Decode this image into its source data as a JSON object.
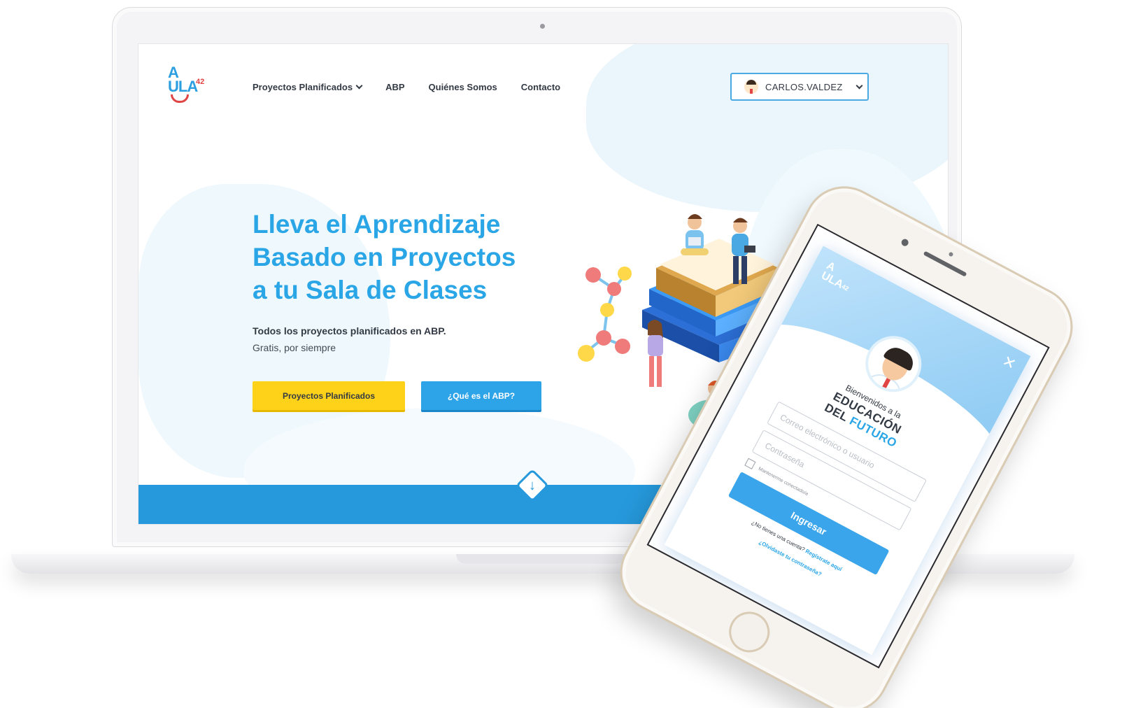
{
  "website": {
    "logo": {
      "top": "A",
      "middle": "ULA",
      "superscript": "42"
    },
    "nav": {
      "items": [
        {
          "label": "Proyectos Planificados",
          "has_dropdown": true
        },
        {
          "label": "ABP"
        },
        {
          "label": "Quiénes Somos"
        },
        {
          "label": "Contacto"
        }
      ]
    },
    "user_menu": {
      "username": "CARLOS.VALDEZ"
    },
    "hero": {
      "title_lines": [
        "Lleva el Aprendizaje",
        "Basado en Proyectos",
        "a tu Sala de Clases"
      ],
      "subtitle": "Todos los proyectos planificados en ABP.",
      "subtitle2": "Gratis, por siempre",
      "primary_button": "Proyectos Planificados",
      "secondary_button": "¿Qué es el ABP?"
    },
    "scroll_icon": "down-arrow-icon"
  },
  "mobile_login": {
    "logo": {
      "top": "A",
      "middle": "ULA",
      "superscript": "42"
    },
    "close_icon": "close-icon",
    "welcome": "Bienvenidos a la",
    "headline_line1": "EDUCACIÓN",
    "headline_line2_prefix": "DEL",
    "headline_line2_highlight": "FUTURO",
    "email_placeholder": "Correo electrónico o usuario",
    "password_placeholder": "Contraseña",
    "remember_label": "Mantenerme conectado/a",
    "submit_label": "Ingresar",
    "register_prompt": "¿No tienes una cuenta?",
    "register_link": "Regístrate aquí",
    "forgot_link": "¿Olvidaste tu contraseña?"
  },
  "colors": {
    "brand_blue": "#2aa6e6",
    "bar_blue": "#2699dc",
    "cta_yellow": "#ffd21a",
    "accent_red": "#e04444",
    "text_dark": "#333a44"
  }
}
